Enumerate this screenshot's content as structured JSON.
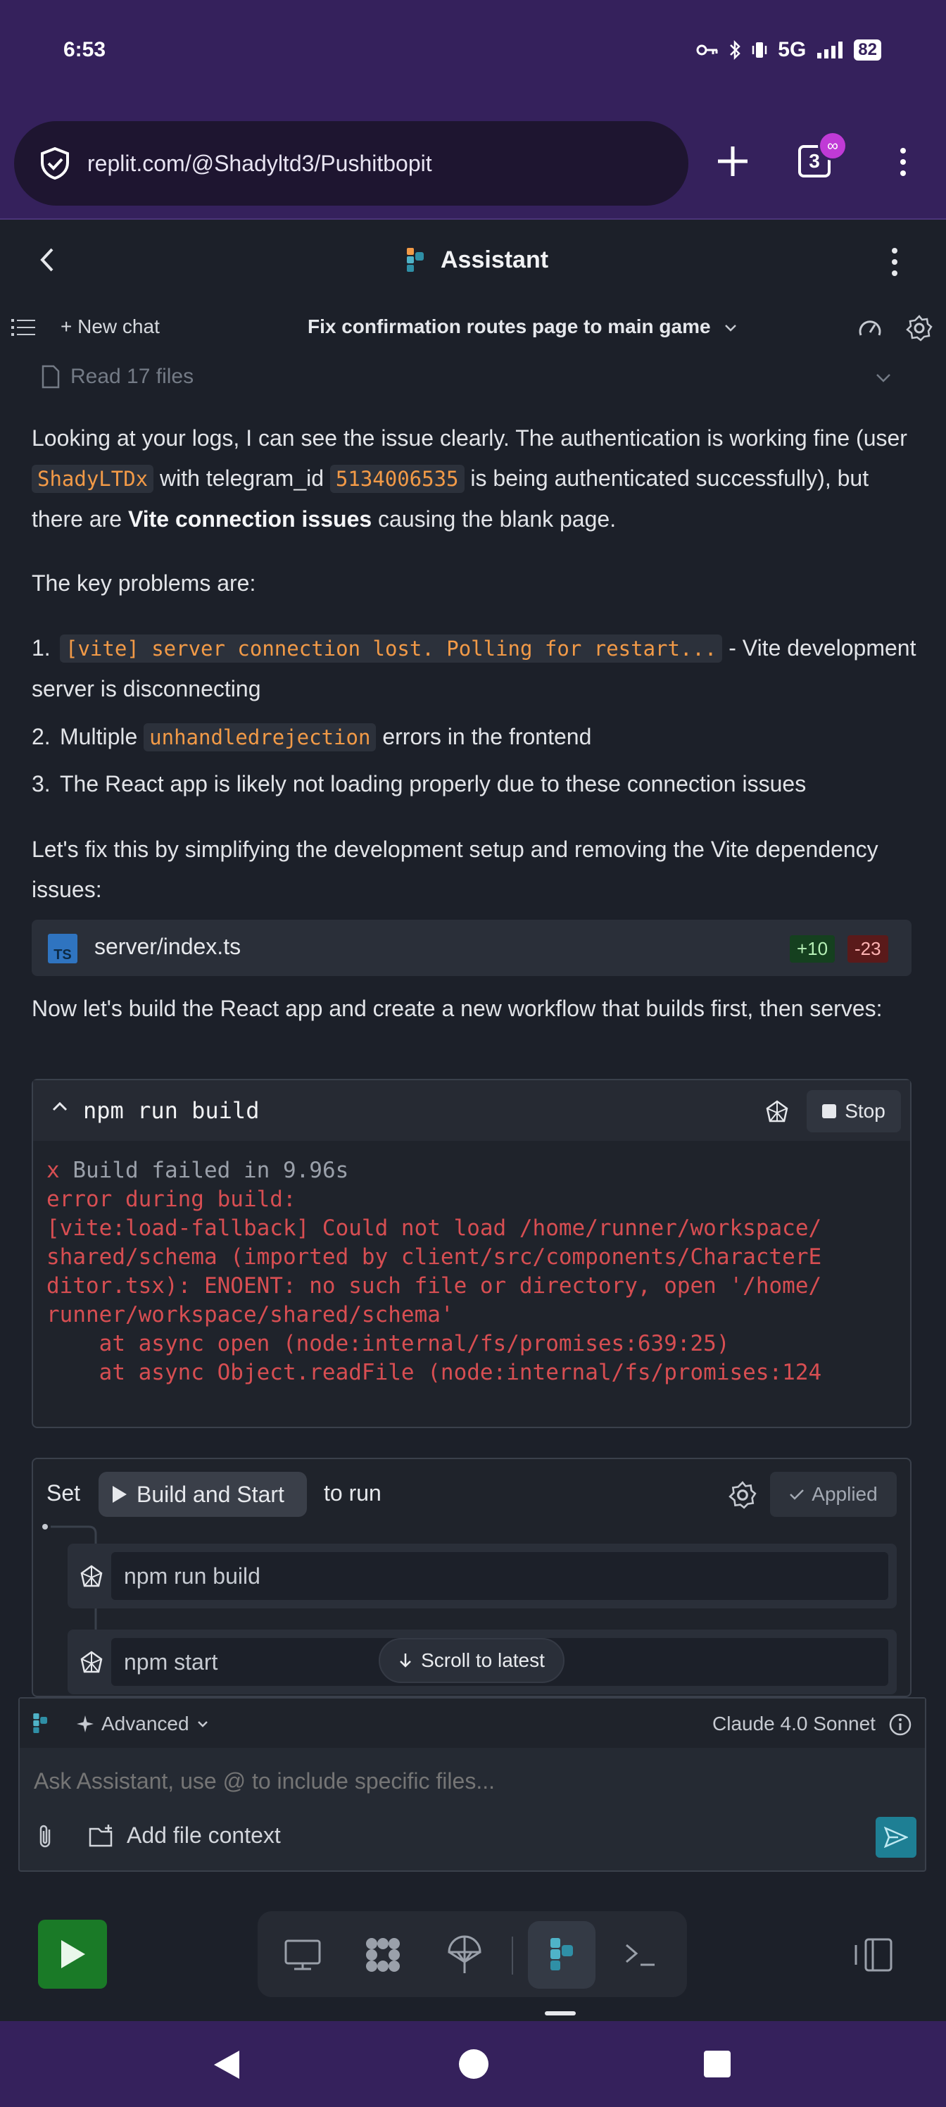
{
  "status_bar": {
    "time": "6:53",
    "network": "5G",
    "battery": "82"
  },
  "browser": {
    "url": "replit.com/@Shadyltd3/Pushitbopit",
    "tab_count": "3",
    "incognito_badge": "∞"
  },
  "header": {
    "title": "Assistant"
  },
  "toolbar": {
    "new_chat": "New chat",
    "chat_title": "Fix confirmation routes page to main game"
  },
  "message": {
    "read_files": "Read 17 files",
    "p1_a": "Looking at your logs, I can see the issue clearly. The authentication is working fine (user ",
    "p1_code1": "ShadyLTDx",
    "p1_b": " with telegram_id ",
    "p1_code2": "5134006535",
    "p1_c": " is being authenticated successfully), but there are ",
    "p1_bold": "Vite connection issues",
    "p1_d": " causing the blank page.",
    "p2": "The key problems are:",
    "list": [
      {
        "num": "1.",
        "code": "[vite] server connection lost. Polling for restart...",
        "text": " - Vite development server is disconnecting"
      },
      {
        "num": "2.",
        "pre": "Multiple ",
        "code": "unhandledrejection",
        "text": " errors in the frontend"
      },
      {
        "num": "3.",
        "text": "The React app is likely not loading properly due to these connection issues"
      }
    ],
    "p3": "Let's fix this by simplifying the development setup and removing the Vite dependency issues:",
    "file_card": {
      "icon": "TS",
      "name": "server/index.ts",
      "added": "+10",
      "removed": "-23"
    },
    "p4": "Now let's build the React app and create a new workflow that builds first, then serves:",
    "terminal": {
      "command": "npm run build",
      "stop_label": "Stop",
      "output_x": "x",
      "output_first": " Build failed in 9.96s",
      "output_rest": "error during build:\n[vite:load-fallback] Could not load /home/runner/workspace/\nshared/schema (imported by client/src/components/CharacterE\nditor.tsx): ENOENT: no such file or directory, open '/home/\nrunner/workspace/shared/schema'\n    at async open (node:internal/fs/promises:639:25)\n    at async Object.readFile (node:internal/fs/promises:124"
    },
    "workflow": {
      "set_label": "Set",
      "workflow_name": "Build and Start",
      "to_run": "to run",
      "applied_label": "Applied",
      "steps": [
        "npm run build",
        "npm start"
      ]
    },
    "scroll_latest": "Scroll to latest"
  },
  "composer": {
    "advanced_label": "Advanced",
    "model": "Claude 4.0 Sonnet",
    "placeholder": "Ask Assistant, use @ to include specific files...",
    "add_context": "Add file context"
  },
  "colors": {
    "accent": "#1e7f94",
    "status_purple": "#35215c",
    "run_green": "#1a7a27",
    "code_orange": "#f29a47",
    "error_red": "#d74e52"
  }
}
